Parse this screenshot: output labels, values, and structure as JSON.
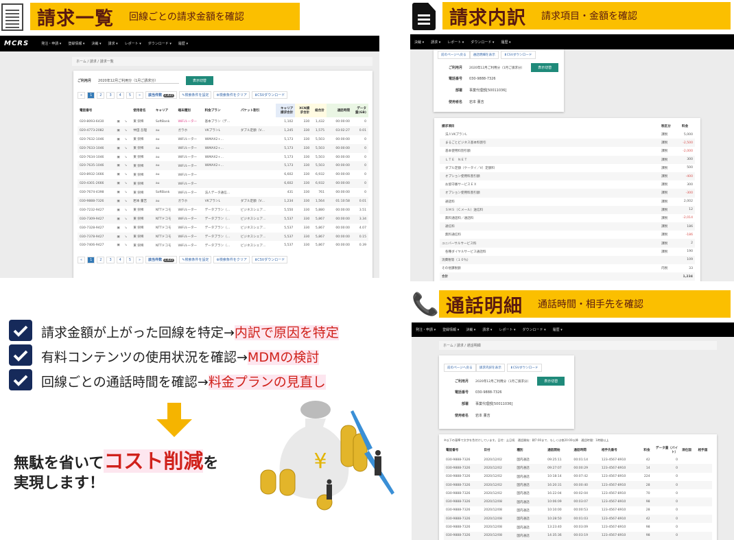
{
  "nav": {
    "logo": "MCRS",
    "items": [
      "発注・申請 ▾",
      "登録情報 ▾",
      "決裁 ▾",
      "請求 ▾",
      "レポート ▾",
      "ダウンロード ▾",
      "履歴 ▾"
    ]
  },
  "panel_list": {
    "title": "請求一覧",
    "subtitle": "回線ごとの請求金額を確認",
    "breadcrumb": "ホーム / 請求 / 請求一覧",
    "month_label": "ご利用月",
    "month_value": "2020年12月ご利用分（1月ご請求分）",
    "switch_button": "表示切替",
    "pages": [
      "«",
      "1",
      "2",
      "3",
      "4",
      "5",
      "»"
    ],
    "count_label": "該当件数",
    "count_value": "1,435",
    "set_filter": "✎検索条件を設定",
    "clear_filter": "⚙検索条件をクリア",
    "csv": "⬇CSVダウンロード",
    "columns": [
      "電話番号",
      "",
      "",
      "使用者名",
      "キャリア",
      "端末種別",
      "料金プラン",
      "パケット割引",
      "キャリア請求合計",
      "XCN請求合計",
      "総合計",
      "通話時間",
      "データ量(GB)"
    ],
    "rows": [
      [
        "020-8093-6430",
        "東 崇稀",
        "SoftBank",
        "WiFiルーター",
        "基本プラン（デ…",
        "",
        "1,102",
        "330",
        "1,432",
        "00:00:00",
        "0"
      ],
      [
        "020-4773-2082",
        "仲田 吾理",
        "au",
        "ガラホ",
        "VKプランL",
        "ダブル定額（V…",
        "1,245",
        "330",
        "1,575",
        "03:02:27",
        "0.01"
      ],
      [
        "020-7632-1046",
        "東 崇稀",
        "au",
        "WiFiルーター",
        "WiMAX2+…",
        "",
        "5,173",
        "330",
        "5,503",
        "00:00:00",
        "0"
      ],
      [
        "020-7633-1046",
        "東 崇稀",
        "au",
        "WiFiルーター",
        "WiMAX2+…",
        "",
        "5,173",
        "330",
        "5,503",
        "00:00:00",
        "0"
      ],
      [
        "020-7634-1046",
        "東 崇稀",
        "au",
        "WiFiルーター",
        "WiMAX2+…",
        "",
        "5,173",
        "330",
        "5,503",
        "00:00:00",
        "0"
      ],
      [
        "020-7635-1046",
        "東 崇稀",
        "au",
        "WiFiルーター",
        "WiMAX2+…",
        "",
        "5,173",
        "330",
        "5,503",
        "00:00:00",
        "0"
      ],
      [
        "020-8932-1666",
        "東 崇稀",
        "au",
        "WiFiルーター",
        "",
        "",
        "6,602",
        "330",
        "6,932",
        "00:00:00",
        "0"
      ],
      [
        "020-4301-2666",
        "東 崇稀",
        "au",
        "WiFiルーター",
        "",
        "",
        "6,602",
        "330",
        "6,932",
        "00:00:00",
        "0"
      ],
      [
        "030-7674-4398",
        "東 崇稀",
        "SoftBank",
        "WiFiルーター",
        "法人データ通信…",
        "",
        "431",
        "330",
        "761",
        "00:00:00",
        "0"
      ],
      [
        "030-9888-7326",
        "岩本 董吉",
        "au",
        "ガラホ",
        "VKプランL",
        "ダブル定額（V…",
        "1,234",
        "330",
        "1,564",
        "01:10:58",
        "0.01"
      ],
      [
        "030-7232-9427",
        "東 崇稀",
        "NTTドコモ",
        "WiFiルーター",
        "データプラン（…",
        "ビジネスシェア…",
        "5,550",
        "330",
        "5,880",
        "00:00:00",
        "3.51"
      ],
      [
        "030-7309-9427",
        "東 崇稀",
        "NTTドコモ",
        "WiFiルーター",
        "データプラン（…",
        "ビジネスシェア…",
        "5,537",
        "330",
        "5,867",
        "00:00:00",
        "3.34"
      ],
      [
        "030-7328-9427",
        "東 崇稀",
        "NTTドコモ",
        "WiFiルーター",
        "データプラン（…",
        "ビジネスシェア…",
        "5,537",
        "330",
        "5,867",
        "00:00:00",
        "4.07"
      ],
      [
        "030-7378-9427",
        "東 崇稀",
        "NTTドコモ",
        "WiFiルーター",
        "データプラン（…",
        "ビジネスシェア…",
        "5,537",
        "330",
        "5,867",
        "00:00:00",
        "0.15"
      ],
      [
        "030-7406-9427",
        "東 崇稀",
        "NTTドコモ",
        "WiFiルーター",
        "データプラン（…",
        "ビジネスシェア…",
        "5,537",
        "330",
        "5,867",
        "00:00:00",
        "0.39"
      ]
    ]
  },
  "panel_breakdown": {
    "title": "請求内訳",
    "subtitle": "請求項目・金額を確認",
    "back": "前のページへ戻る",
    "show_calls": "通話明細を表示",
    "csv": "⬇CSVダウンロード",
    "month_label": "ご利用月",
    "month_value": "2020年12月ご利用分（1月ご請求分）",
    "switch_button": "表示切替",
    "phone_label": "電話番号",
    "phone_value": "030-9888-7326",
    "dept_label": "部署",
    "dept_value": "事業代理部[50011036]",
    "user_label": "使用者名",
    "user_value": "岩本 董吉",
    "columns": [
      "請求項目",
      "税区分",
      "料金"
    ],
    "rows": [
      [
        "法人VKプランL",
        "課税",
        "5,000"
      ],
      [
        "まるごとビジネス基本料割引",
        "課税",
        "-2,500"
      ],
      [
        "基本使用料割引額",
        "課税",
        "-2,000"
      ],
      [
        "ＬＴＥ　ＮＥＴ",
        "課税",
        "300"
      ],
      [
        "ダブル定額（ケータイ／V）定額料",
        "課税",
        "500"
      ],
      [
        "オプション使用料割引額",
        "課税",
        "-400"
      ],
      [
        "お留守番サービスＥＸ",
        "課税",
        "300"
      ],
      [
        "オプション使用料割引額",
        "課税",
        "-300"
      ],
      [
        "通話料",
        "課税",
        "2,002"
      ],
      [
        "ＳＭＳ（Ｃメール）送信料",
        "課税",
        "12"
      ],
      [
        "無料通話料／通話料",
        "課税",
        "-2,014"
      ],
      [
        "通信料",
        "課税",
        "186"
      ],
      [
        "無料通信料",
        "課税",
        "-186"
      ],
      [
        "ユニバーサルサービス料",
        "課税",
        "2"
      ],
      [
        "各種ダイヤルサービス通話料",
        "課税",
        "190"
      ],
      [
        "消費税等（１０％）",
        "",
        "109"
      ],
      [
        "その他課税額",
        "内税",
        "33"
      ],
      [
        "合計",
        "",
        "1,234"
      ]
    ]
  },
  "panel_calls": {
    "title": "通話明細",
    "subtitle": "通話時間・相手先を確認",
    "breadcrumb": "ホーム / 請求 / 通話明細",
    "back": "前のページへ戻る",
    "show_breakdown": "請求内訳を表示",
    "csv": "⬇CSVダウンロード",
    "month_label": "ご利用月",
    "month_value": "2020年12月ご利用分（1月ご請求分）",
    "switch_button": "表示切替",
    "phone_label": "電話番号",
    "phone_value": "030-9888-7326",
    "dept_label": "部署",
    "dept_value": "事業代理部[50011036]",
    "user_label": "使用者名",
    "user_value": "岩本 董吉",
    "note": "※以下の基準で文字を色付けしています。日付：土日祝　通話開始：朝7:00まで、もしくは夜20:00以降　通話時間：1時間以上",
    "columns": [
      "電話番号",
      "日付",
      "種別",
      "通話開始",
      "通話時間",
      "相手先番号",
      "料金",
      "データ量（バイト）",
      "滞在国",
      "相手国"
    ],
    "rows": [
      [
        "030-9888-7326",
        "2020/12/02",
        "国内通話",
        "09:25:11",
        "00:01:14",
        "123-4567-8910",
        "42",
        "0",
        "",
        ""
      ],
      [
        "030-9888-7326",
        "2020/12/02",
        "国内通話",
        "09:27:07",
        "00:00:29",
        "123-4567-8910",
        "14",
        "0",
        "",
        ""
      ],
      [
        "030-9888-7326",
        "2020/12/02",
        "国内通話",
        "10:18:14",
        "00:07:42",
        "123-4567-8910",
        "224",
        "0",
        "",
        ""
      ],
      [
        "030-9888-7326",
        "2020/12/02",
        "国内通話",
        "16:20:31",
        "00:00:40",
        "123-4567-8910",
        "28",
        "0",
        "",
        ""
      ],
      [
        "030-9888-7326",
        "2020/12/02",
        "国内通話",
        "16:22:04",
        "00:02:04",
        "123-4567-8910",
        "70",
        "0",
        "",
        ""
      ],
      [
        "030-9888-7326",
        "2020/12/08",
        "国内通話",
        "10:06:09",
        "00:03:07",
        "123-4567-8910",
        "98",
        "0",
        "",
        ""
      ],
      [
        "030-9888-7326",
        "2020/12/08",
        "国内通話",
        "10:10:00",
        "00:00:53",
        "123-4567-8910",
        "28",
        "0",
        "",
        ""
      ],
      [
        "030-9888-7326",
        "2020/12/08",
        "国内通話",
        "10:28:50",
        "00:01:03",
        "123-4567-8910",
        "42",
        "0",
        "",
        ""
      ],
      [
        "030-9888-7326",
        "2020/12/08",
        "国内通話",
        "13:23:40",
        "00:03:09",
        "123-4567-8910",
        "98",
        "0",
        "",
        ""
      ],
      [
        "030-9888-7326",
        "2020/12/08",
        "国内通話",
        "14:35:36",
        "00:03:19",
        "123-4567-8910",
        "98",
        "0",
        "",
        ""
      ]
    ]
  },
  "benefits": [
    {
      "text": "請求金額が上がった回線を特定→",
      "highlight": "内訳で原因を特定"
    },
    {
      "text": "有料コンテンツの使用状況を確認→",
      "highlight": "MDMの検討"
    },
    {
      "text": "回線ごとの通話時間を確認→",
      "highlight": "料金プランの見直し"
    }
  ],
  "conclusion": {
    "pre": "無駄を省いて",
    "highlight": "コスト削減",
    "post": "を",
    "line2": "実現します！"
  },
  "colors": {
    "banner": "#fbbf00",
    "check": "#162a5a",
    "highlight": "#d0211b",
    "accent_button": "#1f8a7a",
    "arrow": "#f5b400"
  }
}
